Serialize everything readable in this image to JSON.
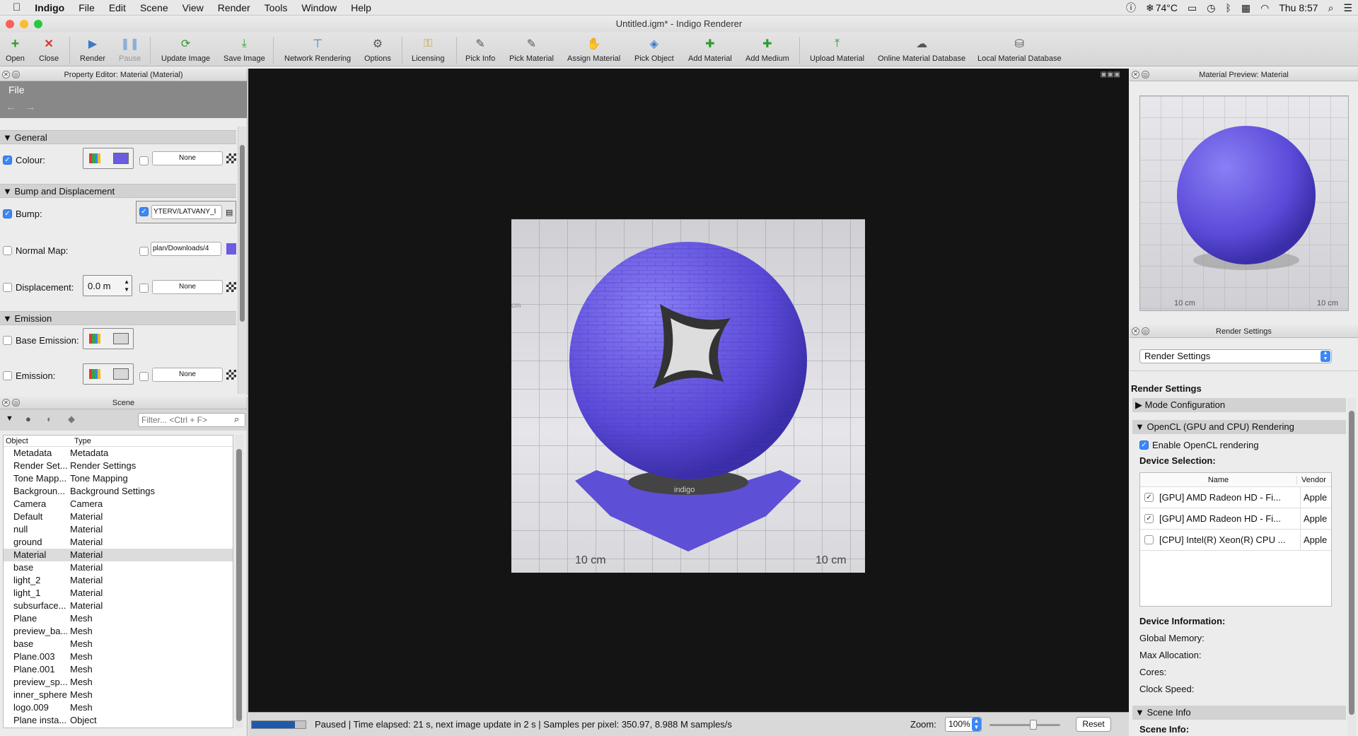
{
  "menubar": {
    "apple": "",
    "app": "Indigo",
    "items": [
      "File",
      "Edit",
      "Scene",
      "View",
      "Render",
      "Tools",
      "Window",
      "Help"
    ],
    "temp": "74°C",
    "clock": "Thu 8:57"
  },
  "window": {
    "title": "Untitled.igm* - Indigo Renderer"
  },
  "toolbar": {
    "open": "Open",
    "close": "Close",
    "render": "Render",
    "pause": "Pause",
    "update_image": "Update Image",
    "save_image": "Save Image",
    "network_rendering": "Network Rendering",
    "options": "Options",
    "licensing": "Licensing",
    "pick_info": "Pick Info",
    "pick_material": "Pick Material",
    "assign_material": "Assign Material",
    "pick_object": "Pick Object",
    "add_material": "Add Material",
    "add_medium": "Add Medium",
    "upload_material": "Upload Material",
    "online_db": "Online Material Database",
    "local_db": "Local Material Database"
  },
  "property_editor": {
    "title": "Property Editor: Material (Material)",
    "menu_file": "File",
    "general": "General",
    "colour_label": "Colour:",
    "colour_swatch": "#6b5ce0",
    "none": "None",
    "bump_section": "Bump and Displacement",
    "bump_label": "Bump:",
    "bump_path": "YTERV/LATVANY_I",
    "normal_label": "Normal Map:",
    "normal_path": "plan/Downloads/4",
    "displacement_label": "Displacement:",
    "displacement_value": "0.0 m",
    "emission_section": "Emission",
    "base_emission_label": "Base Emission:",
    "emission_label": "Emission:"
  },
  "scene": {
    "title": "Scene",
    "filter_placeholder": "Filter... <Ctrl + F>",
    "col_object": "Object",
    "col_type": "Type",
    "rows": [
      {
        "object": "Metadata",
        "type": "Metadata"
      },
      {
        "object": "Render Set...",
        "type": "Render Settings"
      },
      {
        "object": "Tone Mapp...",
        "type": "Tone Mapping"
      },
      {
        "object": "Backgroun...",
        "type": "Background Settings"
      },
      {
        "object": "Camera",
        "type": "Camera"
      },
      {
        "object": "Default",
        "type": "Material"
      },
      {
        "object": "null",
        "type": "Material"
      },
      {
        "object": "ground",
        "type": "Material"
      },
      {
        "object": "Material",
        "type": "Material",
        "selected": true
      },
      {
        "object": "base",
        "type": "Material"
      },
      {
        "object": "light_2",
        "type": "Material"
      },
      {
        "object": "light_1",
        "type": "Material"
      },
      {
        "object": "subsurface...",
        "type": "Material"
      },
      {
        "object": "Plane",
        "type": "Mesh"
      },
      {
        "object": "preview_ba...",
        "type": "Mesh"
      },
      {
        "object": "base",
        "type": "Mesh"
      },
      {
        "object": "Plane.003",
        "type": "Mesh"
      },
      {
        "object": "Plane.001",
        "type": "Mesh"
      },
      {
        "object": "preview_sp...",
        "type": "Mesh"
      },
      {
        "object": "inner_sphere",
        "type": "Mesh"
      },
      {
        "object": "logo.009",
        "type": "Mesh"
      },
      {
        "object": "Plane insta...",
        "type": "Object"
      }
    ]
  },
  "viewport": {
    "status_text": "Paused | Time elapsed: 21 s, next image update in 2 s | Samples per pixel: 350.97, 8.988 M samples/s",
    "progress": 0.8,
    "zoom_label": "Zoom:",
    "zoom_value": "100%",
    "reset": "Reset",
    "ground_label": "10 cm",
    "cm_label": "cm",
    "logo_text": "indigo"
  },
  "material_preview": {
    "title": "Material Preview: Material",
    "ground_label": "10 cm"
  },
  "render_settings": {
    "title": "Render Settings",
    "dropdown": "Render Settings",
    "heading": "Render Settings",
    "mode_config": "Mode Configuration",
    "opencl": "OpenCL (GPU and CPU) Rendering",
    "enable_opencl": "Enable OpenCL rendering",
    "device_selection": "Device Selection:",
    "col_name": "Name",
    "col_vendor": "Vendor",
    "devices": [
      {
        "name": "[GPU] AMD Radeon HD - Fi...",
        "vendor": "Apple",
        "checked": true
      },
      {
        "name": "[GPU] AMD Radeon HD - Fi...",
        "vendor": "Apple",
        "checked": true
      },
      {
        "name": "[CPU] Intel(R) Xeon(R) CPU ...",
        "vendor": "Apple",
        "checked": false
      }
    ],
    "device_info": "Device Information:",
    "global_memory": "Global Memory:",
    "max_allocation": "Max Allocation:",
    "cores": "Cores:",
    "clock_speed": "Clock Speed:",
    "scene_info": "Scene Info",
    "scene_info_sub": "Scene Info:"
  },
  "colors": {
    "accent": "#3b87f7",
    "material": "#6b5ce0"
  }
}
